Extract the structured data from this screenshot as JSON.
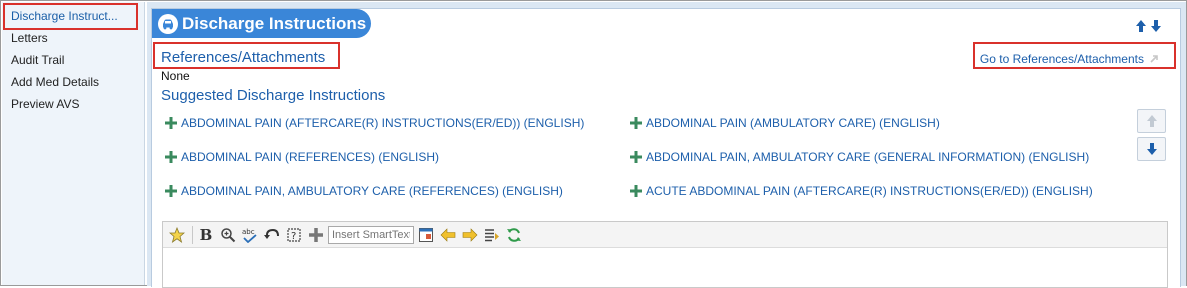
{
  "sidebar": {
    "items": [
      {
        "label": "Discharge Instruct...",
        "active": true
      },
      {
        "label": "Letters"
      },
      {
        "label": "Audit Trail"
      },
      {
        "label": "Add Med Details"
      },
      {
        "label": "Preview AVS"
      }
    ]
  },
  "header": {
    "title": "Discharge Instructions",
    "title_icon": "car-icon"
  },
  "references": {
    "heading": "References/Attachments",
    "value": "None",
    "link_label": "Go to References/Attachments"
  },
  "suggested": {
    "heading": "Suggested Discharge Instructions",
    "items": [
      "ABDOMINAL PAIN (AFTERCARE(R) INSTRUCTIONS(ER/ED)) (ENGLISH)",
      "ABDOMINAL PAIN (AMBULATORY CARE) (ENGLISH)",
      "ABDOMINAL PAIN (REFERENCES) (ENGLISH)",
      "ABDOMINAL PAIN, AMBULATORY CARE (GENERAL INFORMATION) (ENGLISH)",
      "ABDOMINAL PAIN, AMBULATORY CARE (REFERENCES) (ENGLISH)",
      "ACUTE ABDOMINAL PAIN (AFTERCARE(R) INSTRUCTIONS(ER/ED)) (ENGLISH)"
    ]
  },
  "editor": {
    "smarttext_placeholder": "Insert SmartText",
    "toolbar_icons": [
      "favorites-star-icon",
      "bold-icon",
      "zoom-icon",
      "spellcheck-icon",
      "undo-icon",
      "help-icon",
      "add-icon",
      "smarttext-lookup-icon",
      "arrow-left-icon",
      "arrow-right-icon",
      "insert-list-icon",
      "refresh-icon"
    ]
  },
  "colors": {
    "accent": "#3a86d8",
    "link": "#1d5fab",
    "plus": "#3a8a5e",
    "highlight_box": "#d9312b",
    "sidebar_bg": "#eef4fa",
    "main_bg": "#dbe7f3"
  }
}
